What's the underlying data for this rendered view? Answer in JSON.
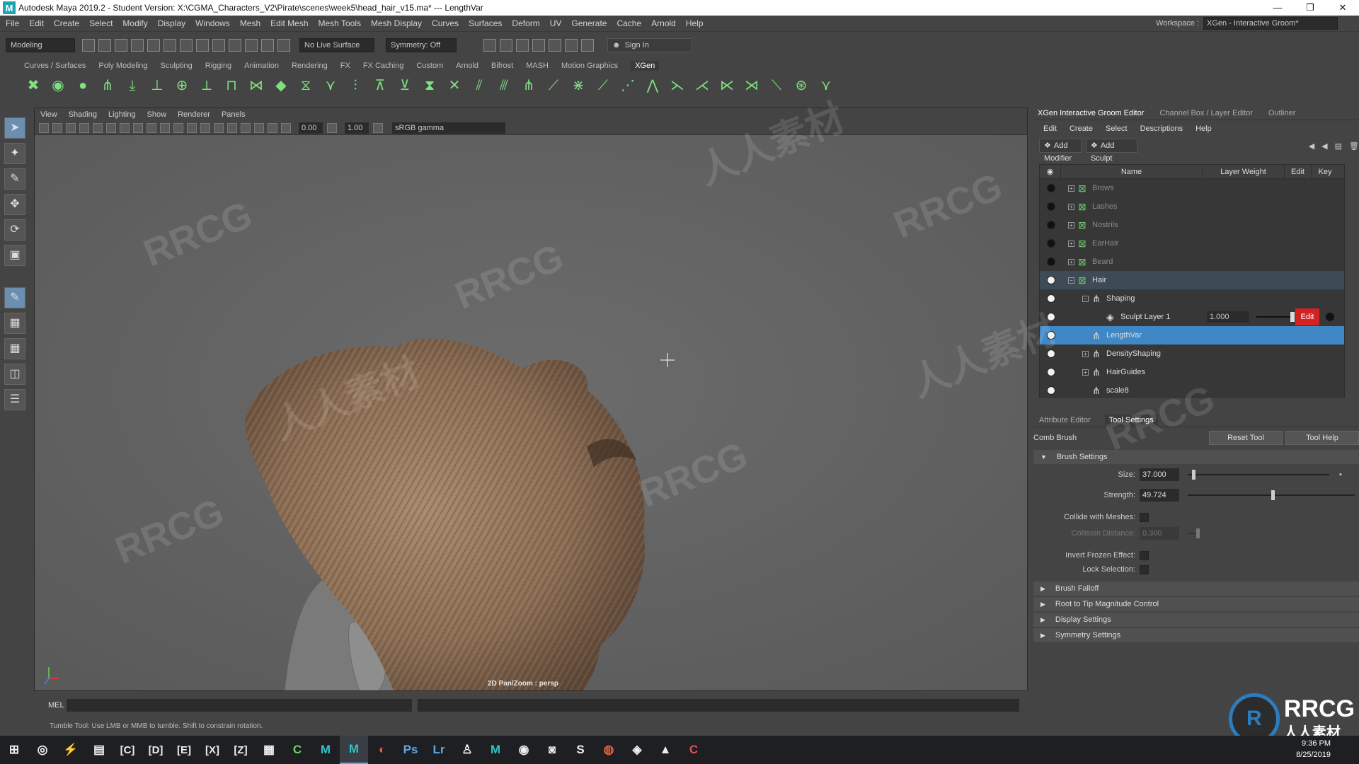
{
  "window": {
    "title": "Autodesk Maya 2019.2 - Student Version: X:\\CGMA_Characters_V2\\Pirate\\scenes\\week5\\head_hair_v15.ma*   ---   LengthVar",
    "controls": [
      "—",
      "❐",
      "✕"
    ]
  },
  "menubar": {
    "items": [
      "File",
      "Edit",
      "Create",
      "Select",
      "Modify",
      "Display",
      "Windows",
      "Mesh",
      "Edit Mesh",
      "Mesh Tools",
      "Mesh Display",
      "Curves",
      "Surfaces",
      "Deform",
      "UV",
      "Generate",
      "Cache",
      "Arnold",
      "Help"
    ],
    "workspace_label": "Workspace :",
    "workspace_value": "XGen - Interactive Groom*"
  },
  "statusline": {
    "mode": "Modeling",
    "live_surface": "No Live Surface",
    "symmetry": "Symmetry: Off",
    "sign_in": "Sign In"
  },
  "shelf": {
    "tabs": [
      "Curves / Surfaces",
      "Poly Modeling",
      "Sculpting",
      "Rigging",
      "Animation",
      "Rendering",
      "FX",
      "FX Caching",
      "Custom",
      "Arnold",
      "Bifrost",
      "MASH",
      "Motion Graphics",
      "XGen"
    ],
    "active_tab": "XGen",
    "icon_names": [
      "xgen-editor-icon",
      "create-description-icon",
      "create-collection-icon",
      "place-guide-icon",
      "sculpt-guide-icon",
      "add-guide-icon",
      "clump-guide-icon",
      "cut-icon",
      "freeze-icon",
      "smooth-icon",
      "layer-icon",
      "groom-comb-icon",
      "length-icon",
      "noise-icon",
      "bend-icon",
      "density-icon",
      "grab-icon",
      "part-icon",
      "brush-icon",
      "tool-1-icon",
      "tool-2-icon",
      "tool-3-icon",
      "tool-4-icon",
      "tool-5-icon",
      "tool-6-icon",
      "tool-7-icon",
      "tool-8-icon",
      "tool-9-icon",
      "tool-10-icon",
      "tool-11-icon",
      "tool-12-icon",
      "tool-13-icon",
      "tool-14-icon"
    ]
  },
  "viewport": {
    "menu": [
      "View",
      "Shading",
      "Lighting",
      "Show",
      "Renderer",
      "Panels"
    ],
    "near": "0.00",
    "far": "1.00",
    "colorspace": "sRGB gamma",
    "camera_label": "2D Pan/Zoom : persp"
  },
  "commandline": {
    "label": "MEL",
    "help_text": "Tumble Tool: Use LMB or MMB to tumble. Shift to constrain rotation."
  },
  "groom_editor": {
    "tabs": [
      "XGen Interactive Groom Editor",
      "Channel Box / Layer Editor",
      "Outliner"
    ],
    "menu": [
      "Edit",
      "Create",
      "Select",
      "Descriptions",
      "Help"
    ],
    "add_modifier": "Add Modifier",
    "add_sculpt_layer": "Add Sculpt Layer",
    "columns": [
      "Name",
      "Layer Weight",
      "Edit",
      "Key"
    ],
    "rows": [
      {
        "name": "Brows",
        "visible": false
      },
      {
        "name": "Lashes",
        "visible": false
      },
      {
        "name": "Nostrils",
        "visible": false
      },
      {
        "name": "EarHair",
        "visible": false
      },
      {
        "name": "Beard",
        "visible": false
      },
      {
        "name": "Hair",
        "visible": true
      },
      {
        "name": "Shaping",
        "visible": true
      },
      {
        "name": "Sculpt Layer 1",
        "visible": true,
        "weight": "1.000",
        "edit": "Edit"
      },
      {
        "name": "LengthVar",
        "visible": true
      },
      {
        "name": "DensityShaping",
        "visible": true
      },
      {
        "name": "HairGuides",
        "visible": true
      },
      {
        "name": "scale8",
        "visible": true
      }
    ]
  },
  "attribute_editor": {
    "tabs": [
      "Attribute Editor",
      "Tool Settings"
    ],
    "tool_name": "Comb Brush",
    "reset_tool": "Reset Tool",
    "tool_help": "Tool Help",
    "brush_settings": "Brush Settings",
    "size_label": "Size:",
    "size_value": "37.000",
    "size_level": 0.03,
    "strength_label": "Strength:",
    "strength_value": "49.724",
    "strength_level": 0.5,
    "collide_label": "Collide with Meshes:",
    "collision_label": "Collision Distance:",
    "collision_value": "0.300",
    "invert_label": "Invert Frozen Effect:",
    "lock_label": "Lock Selection:",
    "sections": [
      "Brush Falloff",
      "Root to Tip Magnitude Control",
      "Display Settings",
      "Symmetry Settings"
    ]
  },
  "taskbar": {
    "icons": [
      "windows-start-icon",
      "chrome-icon",
      "winamp-icon",
      "file-explorer-icon",
      "drive-c-icon",
      "drive-d-icon",
      "drive-e-icon",
      "drive-x-icon",
      "drive-z-icon",
      "app-folder-icon",
      "camtasia-icon",
      "maya-icon",
      "maya-active-icon",
      "app-red-icon",
      "photoshop-icon",
      "lightroom-icon",
      "app-person-icon",
      "maya-2-icon",
      "obs-icon",
      "discord-icon",
      "substance-icon",
      "blender-icon",
      "steam-icon",
      "photos-icon",
      "camtasia-2-icon"
    ],
    "labels": [
      "",
      "",
      "",
      "",
      "[C]",
      "[D]",
      "[E]",
      "[X]",
      "[Z]",
      "",
      "",
      "M",
      "M",
      "",
      "Ps",
      "Lr",
      "",
      "M",
      "",
      "",
      "",
      "",
      "",
      "",
      "C"
    ],
    "time": "9:36 PM",
    "date": "8/25/2019"
  },
  "watermark": {
    "text": "RRCG",
    "text_cn": "人人素材",
    "brand_cn": "人人素材"
  }
}
